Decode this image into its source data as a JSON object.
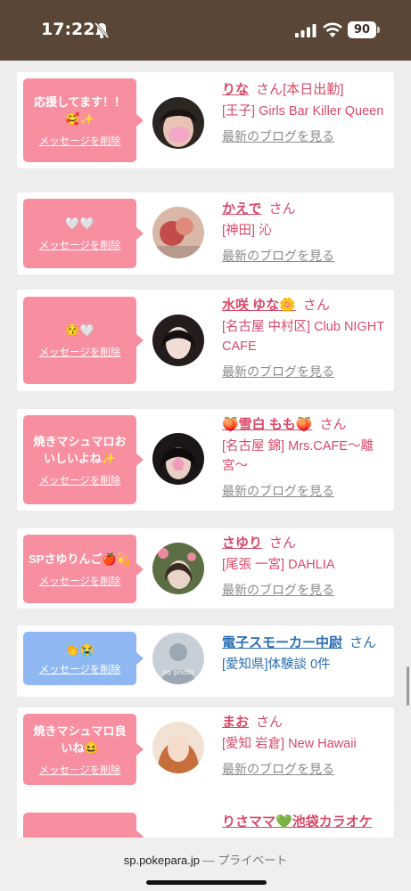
{
  "status": {
    "time": "17:22",
    "battery": "90"
  },
  "browser": {
    "domain": "sp.pokepara.jp",
    "separator": " — ",
    "mode": "プライベート"
  },
  "delete_label": "メッセージを削除",
  "blog_label": "最新のブログを見る",
  "cards": [
    {
      "message": "応援してます！！🥰✨",
      "name": "りな",
      "honorific": "さん",
      "badge": "[本日出勤]",
      "shop": "[王子] Girls Bar Killer Queen",
      "blog": "最新のブログを見る"
    },
    {
      "message": "🤍🤍",
      "name": "かえで",
      "honorific": "さん",
      "shop": "[神田] 沁",
      "blog": "最新のブログを見る"
    },
    {
      "message": "😚🤍",
      "name": "水咲 ゆな🌼",
      "honorific": "さん",
      "shop": "[名古屋 中村区] Club NIGHT CAFE",
      "blog": "最新のブログを見る"
    },
    {
      "message": "焼きマシュマロおいしいよね✨",
      "name": "🍑雪白 もも🍑",
      "honorific": "さん",
      "shop": "[名古屋 錦] Mrs.CAFE〜離宮〜",
      "blog": "最新のブログを見る"
    },
    {
      "message": "SPさゆりんご🍎💫",
      "name": "さゆり",
      "honorific": "さん",
      "shop": "[尾張 一宮] DAHLIA",
      "blog": "最新のブログを見る"
    },
    {
      "message": "👏😭",
      "name": "電子スモーカー中尉",
      "honorific": "さん",
      "shop": "[愛知県]体験談 0件",
      "avatar_text": "no photo"
    },
    {
      "message": "焼きマシュマロ良いね😆",
      "name": "まお",
      "honorific": "さん",
      "shop": "[愛知 岩倉] New Hawaii",
      "blog": "最新のブログを見る"
    },
    {
      "name": "りさママ💚池袋カラオケ"
    }
  ]
}
